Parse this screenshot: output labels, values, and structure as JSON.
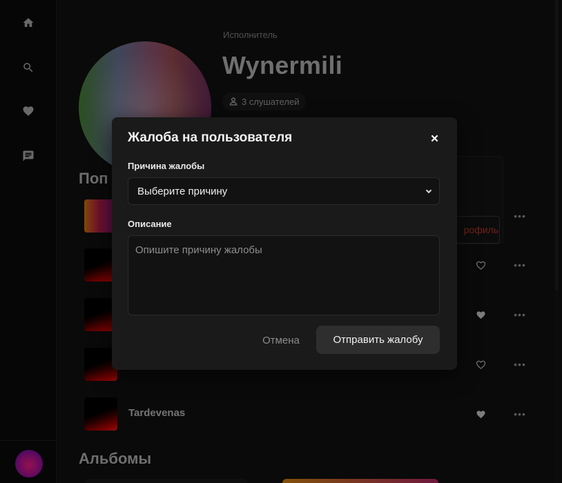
{
  "sidebar": {
    "items": [
      {
        "icon": "home-icon"
      },
      {
        "icon": "search-icon"
      },
      {
        "icon": "heart-icon"
      },
      {
        "icon": "chat-icon"
      }
    ]
  },
  "artist": {
    "type_label": "Исполнитель",
    "name": "Wynermili",
    "listeners": "3 слушателей"
  },
  "sections": {
    "popular_title_partial": "Поп",
    "albums_title": "Альбомы"
  },
  "context_menu": {
    "visible_item_partial": "рофиль"
  },
  "tracks": [
    {
      "title": "",
      "liked": null
    },
    {
      "title": "",
      "liked": false
    },
    {
      "title": "",
      "liked": true
    },
    {
      "title": "",
      "liked": false
    },
    {
      "title": "Tardevenas",
      "liked": true
    }
  ],
  "dialog": {
    "title": "Жалоба на пользователя",
    "reason_label": "Причина жалобы",
    "reason_value": "Выберите причину",
    "description_label": "Описание",
    "description_placeholder": "Опишите причину жалобы",
    "cancel_label": "Отмена",
    "submit_label": "Отправить жалобу"
  },
  "colors": {
    "accent_danger": "#c0392b",
    "dialog_bg": "#1a1a1a",
    "submit_bg": "#2e2e2e"
  }
}
